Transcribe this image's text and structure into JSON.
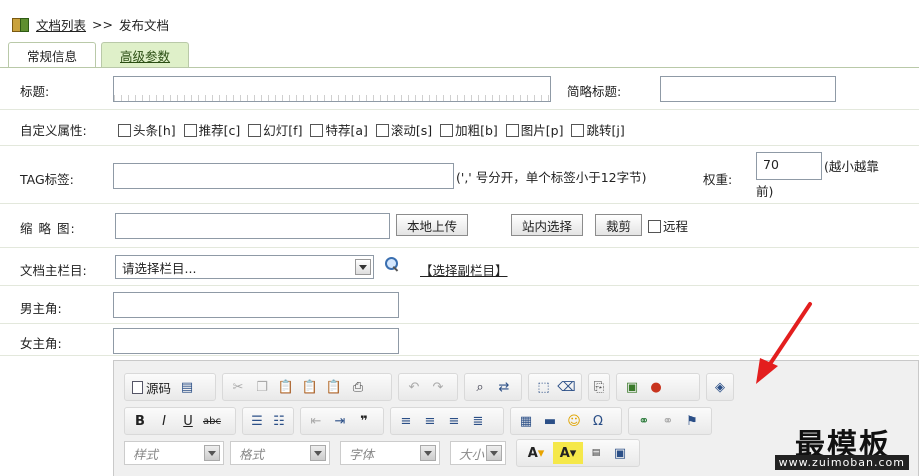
{
  "breadcrumb": {
    "list_link": "文档列表",
    "separator": ">>",
    "current": "发布文档"
  },
  "tabs": [
    {
      "label": "常规信息"
    },
    {
      "label": "高级参数"
    }
  ],
  "form": {
    "title_label": "标题:",
    "short_title_label": "简略标题:",
    "custom_attr_label": "自定义属性:",
    "attrs": [
      "头条[h]",
      "推荐[c]",
      "幻灯[f]",
      "特荐[a]",
      "滚动[s]",
      "加粗[b]",
      "图片[p]",
      "跳转[j]"
    ],
    "tag_label": "TAG标签:",
    "tag_hint": "(',' 号分开，单个标签小于12字节)",
    "weight_label": "权重:",
    "weight_value": "70",
    "weight_hint_1": "(越小越靠",
    "weight_hint_2": "前)",
    "thumb_label": "缩 略 图:",
    "upload_btn": "本地上传",
    "site_select_btn": "站内选择",
    "crop_btn": "裁剪",
    "remote_label": "远程",
    "category_label": "文档主栏目:",
    "category_value": "请选择栏目...",
    "sub_category_link": "【选择副栏目】",
    "actor_label": "男主角:",
    "actress_label": "女主角:"
  },
  "editor": {
    "source_label": "源码",
    "style_combo": "样式",
    "format_combo": "格式",
    "font_combo": "字体",
    "size_combo": "大小"
  },
  "watermark": {
    "main": "最模板",
    "url": "www.zuimoban.com"
  }
}
